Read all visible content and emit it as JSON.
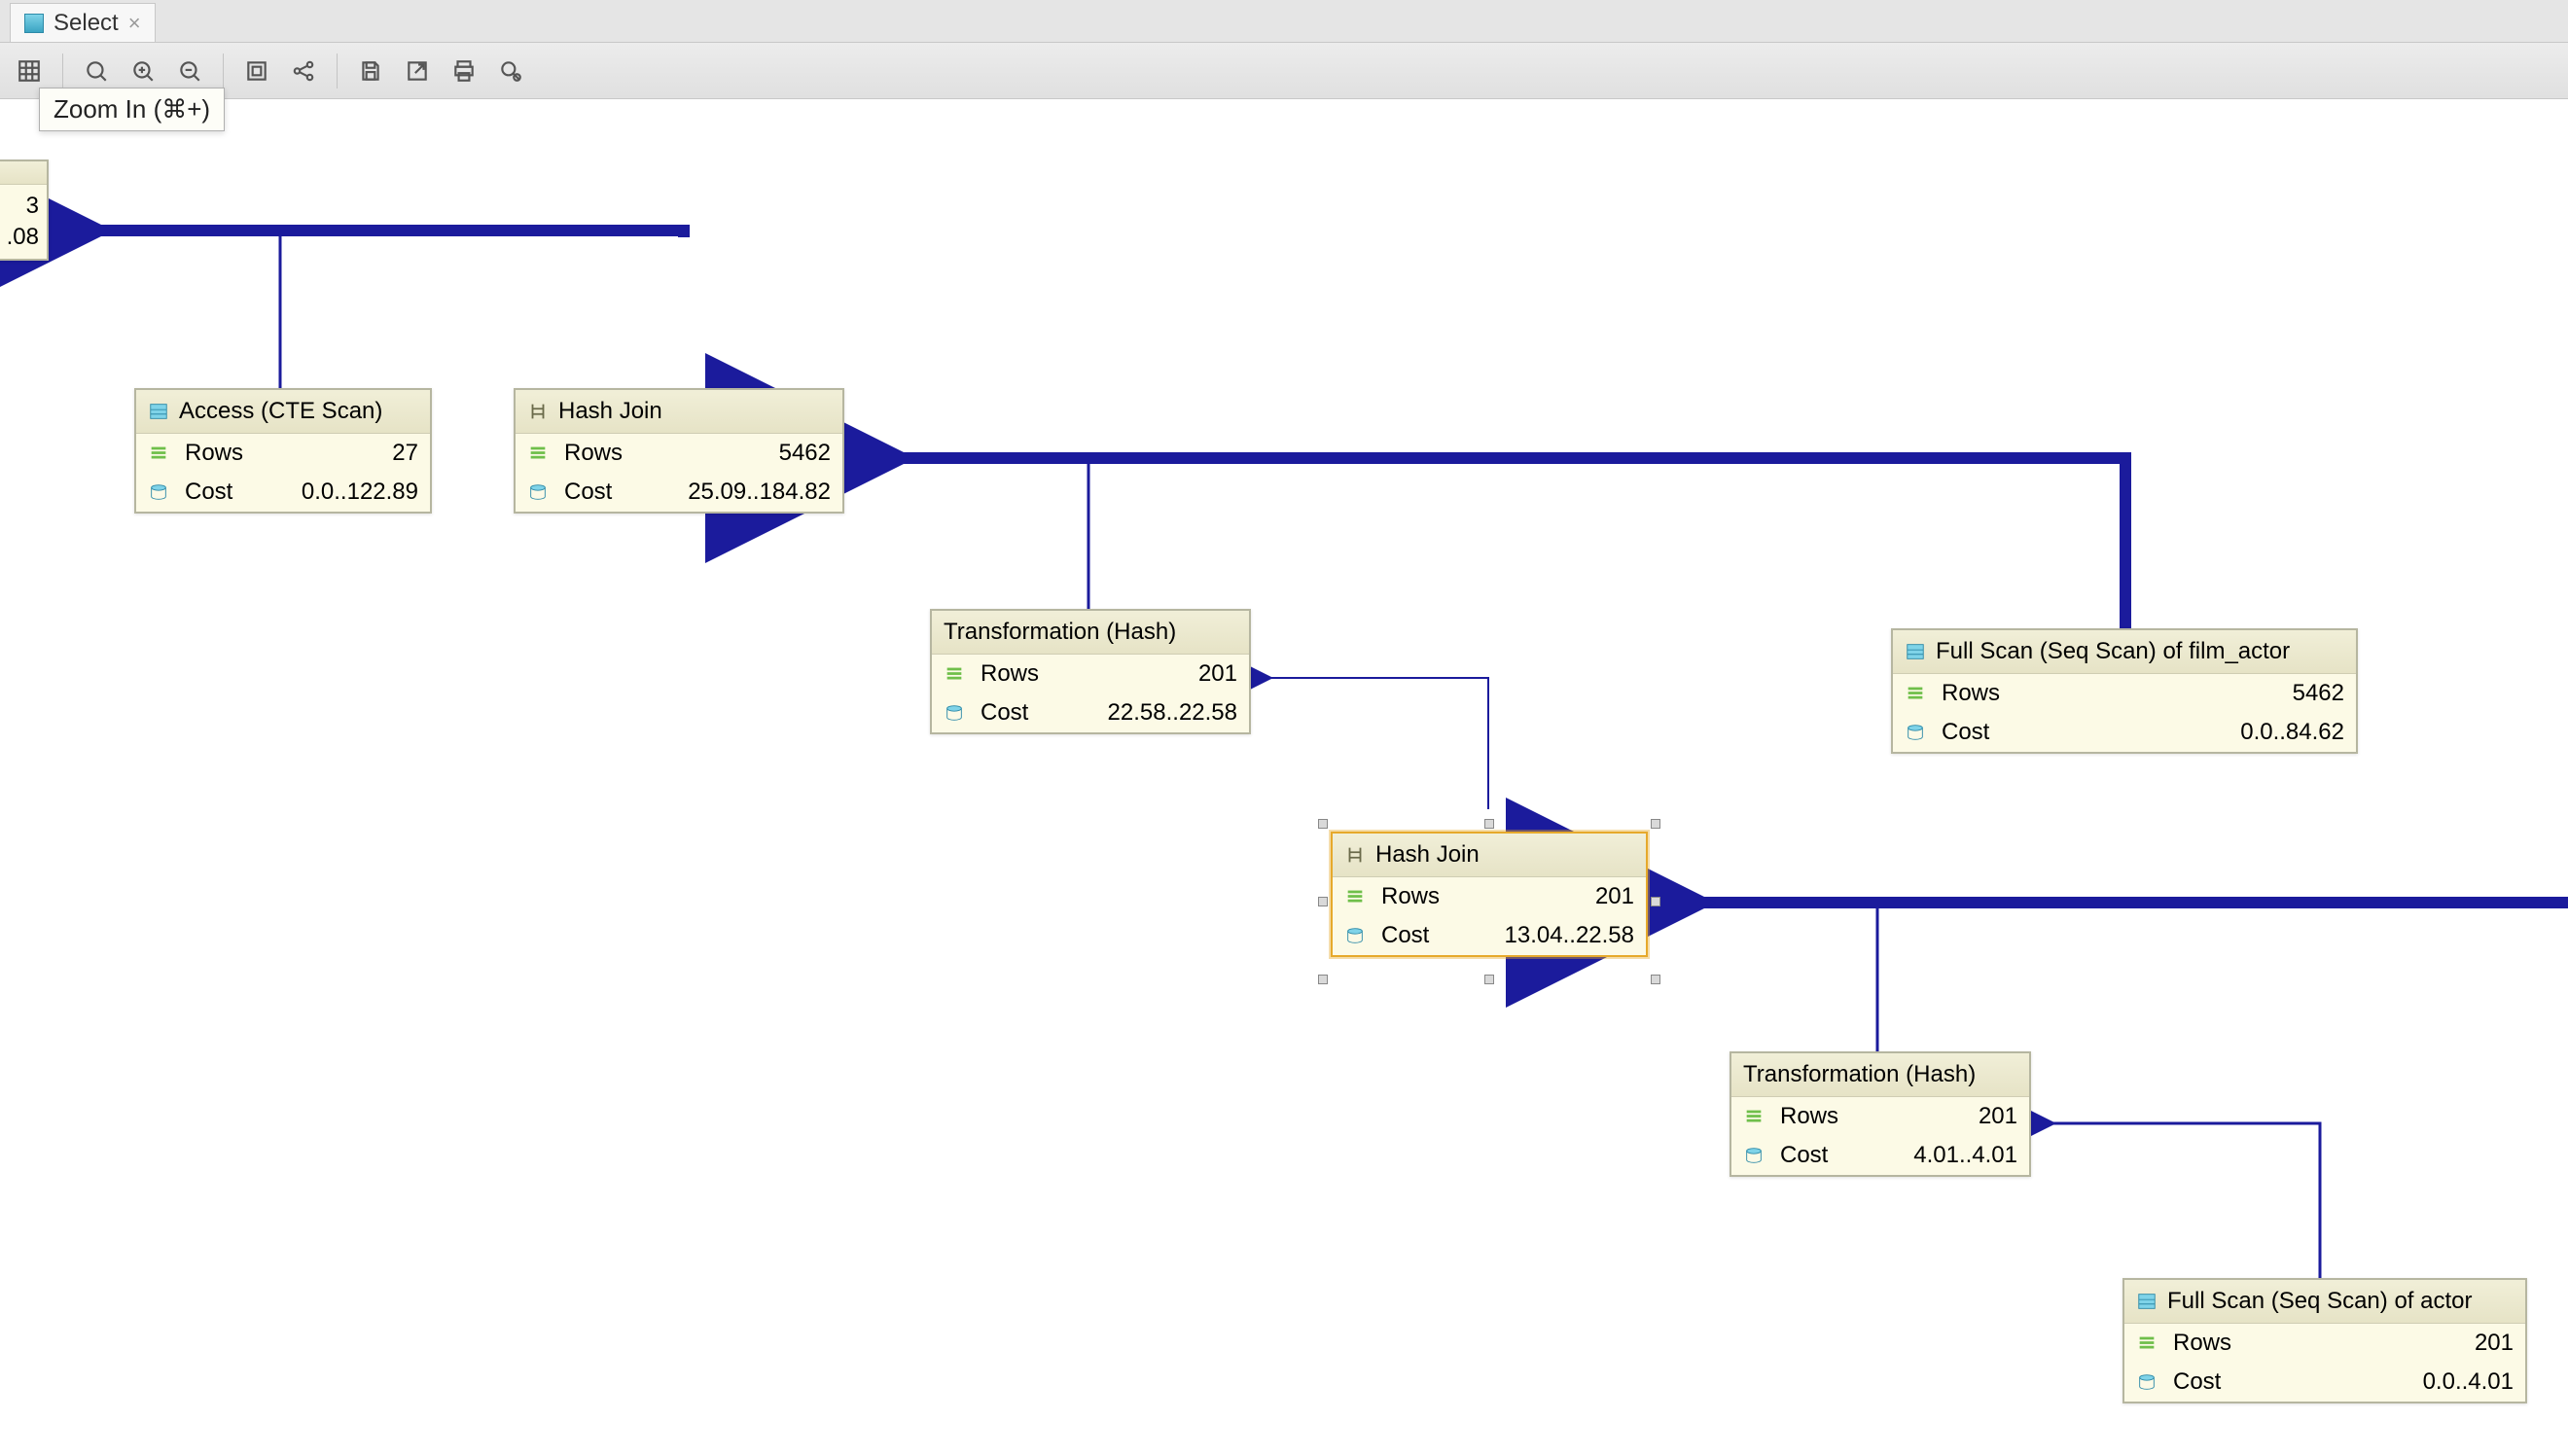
{
  "tab": {
    "label": "Select"
  },
  "tooltip": "Zoom In (⌘+)",
  "result_partial": {
    "line1": "3",
    "line2": ".08"
  },
  "nodes": {
    "access_cte": {
      "title": "Access (CTE Scan)",
      "rows_label": "Rows",
      "rows": "27",
      "cost_label": "Cost",
      "cost": "0.0..122.89"
    },
    "hashjoin1": {
      "title": "Hash Join",
      "rows_label": "Rows",
      "rows": "5462",
      "cost_label": "Cost",
      "cost": "25.09..184.82"
    },
    "transform1": {
      "title": "Transformation (Hash)",
      "rows_label": "Rows",
      "rows": "201",
      "cost_label": "Cost",
      "cost": "22.58..22.58"
    },
    "fullscan_filmactor": {
      "title": "Full Scan (Seq Scan) of film_actor",
      "rows_label": "Rows",
      "rows": "5462",
      "cost_label": "Cost",
      "cost": "0.0..84.62"
    },
    "hashjoin2": {
      "title": "Hash Join",
      "rows_label": "Rows",
      "rows": "201",
      "cost_label": "Cost",
      "cost": "13.04..22.58"
    },
    "transform2": {
      "title": "Transformation (Hash)",
      "rows_label": "Rows",
      "rows": "201",
      "cost_label": "Cost",
      "cost": "4.01..4.01"
    },
    "fullscan_actor": {
      "title": "Full Scan (Seq Scan) of actor",
      "rows_label": "Rows",
      "rows": "201",
      "cost_label": "Cost",
      "cost": "0.0..4.01"
    }
  },
  "toolbar_icons": [
    "grid",
    "zoom-fit",
    "zoom-in",
    "zoom-out",
    "fit-page",
    "share",
    "save",
    "export",
    "print",
    "inspect"
  ]
}
